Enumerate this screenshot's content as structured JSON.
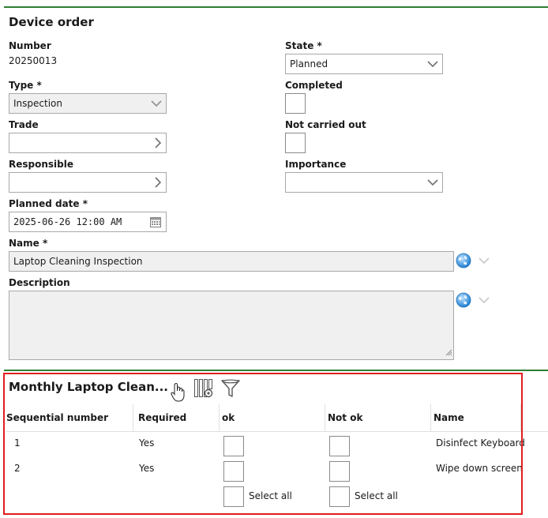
{
  "form": {
    "title": "Device order",
    "number_label": "Number",
    "number_value": "20250013",
    "state_label": "State *",
    "state_value": "Planned",
    "type_label": "Type *",
    "type_value": "Inspection",
    "completed_label": "Completed",
    "trade_label": "Trade",
    "trade_value": "",
    "not_carried_out_label": "Not carried out",
    "responsible_label": "Responsible",
    "responsible_value": "",
    "importance_label": "Importance",
    "importance_value": "",
    "planned_date_label": "Planned date *",
    "planned_date_value": "2025-06-26 12:00 AM",
    "name_label": "Name *",
    "name_value": "Laptop Cleaning Inspection",
    "description_label": "Description",
    "description_value": ""
  },
  "checklist": {
    "title": "Monthly Laptop Clean...",
    "columns": [
      "Sequential number",
      "Required",
      "ok",
      "Not ok",
      "Name"
    ],
    "rows": [
      {
        "seq": "1",
        "required": "Yes",
        "name": "Disinfect Keyboard"
      },
      {
        "seq": "2",
        "required": "Yes",
        "name": "Wipe down screen"
      }
    ],
    "select_all_label": "Select all"
  },
  "colors": {
    "accent_green": "#2e7d32",
    "highlight_red": "#e01e1e"
  },
  "icons": [
    "chevron-down-icon",
    "chevron-right-icon",
    "calendar-icon",
    "globe-icon",
    "column-settings-icon",
    "filter-icon",
    "hand-cursor-icon"
  ]
}
